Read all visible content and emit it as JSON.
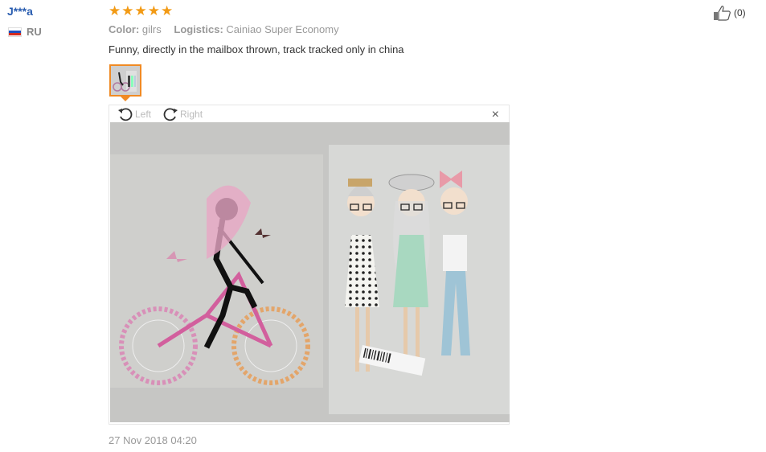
{
  "review": {
    "user": "J***a",
    "country": "RU",
    "rating_stars": 5,
    "color_label": "Color:",
    "color_value": "gilrs",
    "logistics_label": "Logistics:",
    "logistics_value": "Cainiao Super Economy",
    "text": "Funny, directly in the mailbox thrown, track tracked only in china",
    "date": "27 Nov 2018 04:20",
    "likes": "(0)"
  },
  "viewer": {
    "rotate_left": "Left",
    "rotate_right": "Right",
    "close": "×"
  },
  "colors": {
    "user_link": "#2a5db0",
    "star": "#f29a14",
    "thumb_border": "#f08a24"
  },
  "icons": [
    "star-icon",
    "rotate-left-icon",
    "rotate-right-icon",
    "close-icon",
    "thumbs-up-icon",
    "ru-flag-icon"
  ]
}
